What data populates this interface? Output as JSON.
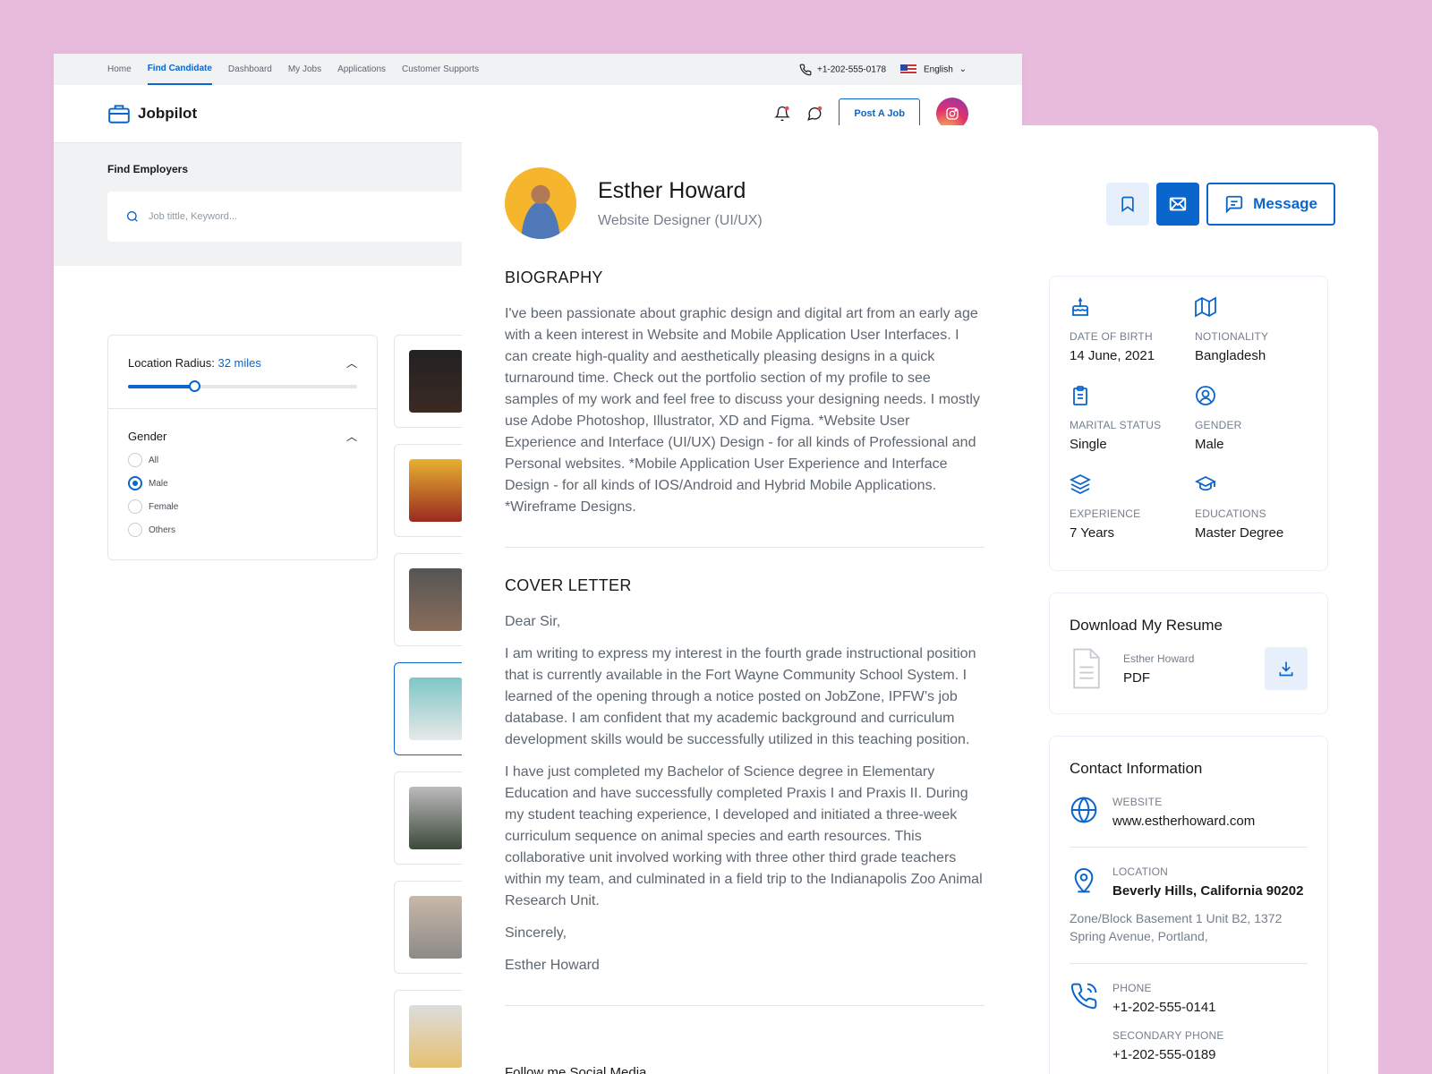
{
  "topnav": {
    "items": [
      "Home",
      "Find Candidate",
      "Dashboard",
      "My Jobs",
      "Applications",
      "Customer Supports"
    ],
    "active": "Find Candidate",
    "phone": "+1-202-555-0178",
    "language": "English"
  },
  "header": {
    "logo": "Jobpilot",
    "post_job": "Post A Job"
  },
  "search": {
    "title": "Find Employers",
    "placeholder": "Job tittle, Keyword..."
  },
  "filters": {
    "radius_label": "Location Radius:",
    "radius_value": "32 miles",
    "radius_fraction": 0.29,
    "gender_title": "Gender",
    "gender_options": [
      "All",
      "Male",
      "Female",
      "Others"
    ],
    "gender_selected": "Male"
  },
  "profile": {
    "name": "Esther Howard",
    "role": "Website Designer (UI/UX)",
    "message_label": "Message"
  },
  "biography": {
    "title": "BIOGRAPHY",
    "text": "I've been passionate about graphic design and digital art from an early age with a keen interest in Website and Mobile Application User Interfaces. I can create high-quality and aesthetically pleasing designs in a quick turnaround time. Check out the portfolio section of my profile to see samples of my work and feel free to discuss your designing needs. I mostly use Adobe Photoshop, Illustrator, XD and Figma. *Website User Experience and Interface (UI/UX) Design - for all kinds of Professional and Personal websites. *Mobile Application User Experience and Interface Design - for all kinds of IOS/Android and Hybrid Mobile Applications. *Wireframe Designs."
  },
  "cover_letter": {
    "title": "COVER LETTER",
    "greeting": "Dear Sir,",
    "para1": "I am writing to express my interest in the fourth grade instructional position that is currently available in the Fort Wayne Community School System. I learned of the opening through a notice posted on JobZone, IPFW’s job database. I am confident that my academic background and curriculum development skills would be successfully utilized in this teaching position.",
    "para2": "I have just completed my Bachelor of Science degree in Elementary Education and have successfully completed Praxis I and Praxis II. During my student teaching experience, I developed and initiated a three-week curriculum sequence on animal species and earth resources. This collaborative unit involved working with three other third grade teachers within my team, and culminated in a field trip to the Indianapolis Zoo Animal Research Unit.",
    "closing": "Sincerely,",
    "signature": "Esther Howard"
  },
  "follow_label": "Follow me Social Media",
  "overview": [
    {
      "icon": "cake-icon",
      "label": "DATE OF BIRTH",
      "value": "14 June, 2021"
    },
    {
      "icon": "map-icon",
      "label": "NOTIONALITY",
      "value": "Bangladesh"
    },
    {
      "icon": "clipboard-icon",
      "label": "MARITAL STATUS",
      "value": "Single"
    },
    {
      "icon": "user-circle-icon",
      "label": "GENDER",
      "value": "Male"
    },
    {
      "icon": "stack-icon",
      "label": "EXPERIENCE",
      "value": "7 Years"
    },
    {
      "icon": "graduation-cap-icon",
      "label": "EDUCATIONS",
      "value": "Master Degree"
    }
  ],
  "resume": {
    "title": "Download My Resume",
    "name": "Esther Howard",
    "type": "PDF"
  },
  "contact": {
    "title": "Contact Information",
    "website_label": "WEBSITE",
    "website": "www.estherhoward.com",
    "location_label": "LOCATION",
    "location": "Beverly Hills, California 90202",
    "address": "Zone/Block Basement 1 Unit B2, 1372 Spring Avenue, Portland,",
    "phone_label": "PHONE",
    "phone": "+1-202-555-0141",
    "secondary_label": "SECONDARY PHONE",
    "secondary": "+1-202-555-0189"
  },
  "colors": {
    "accent": "#0a65cc",
    "background": "#e8badc"
  }
}
